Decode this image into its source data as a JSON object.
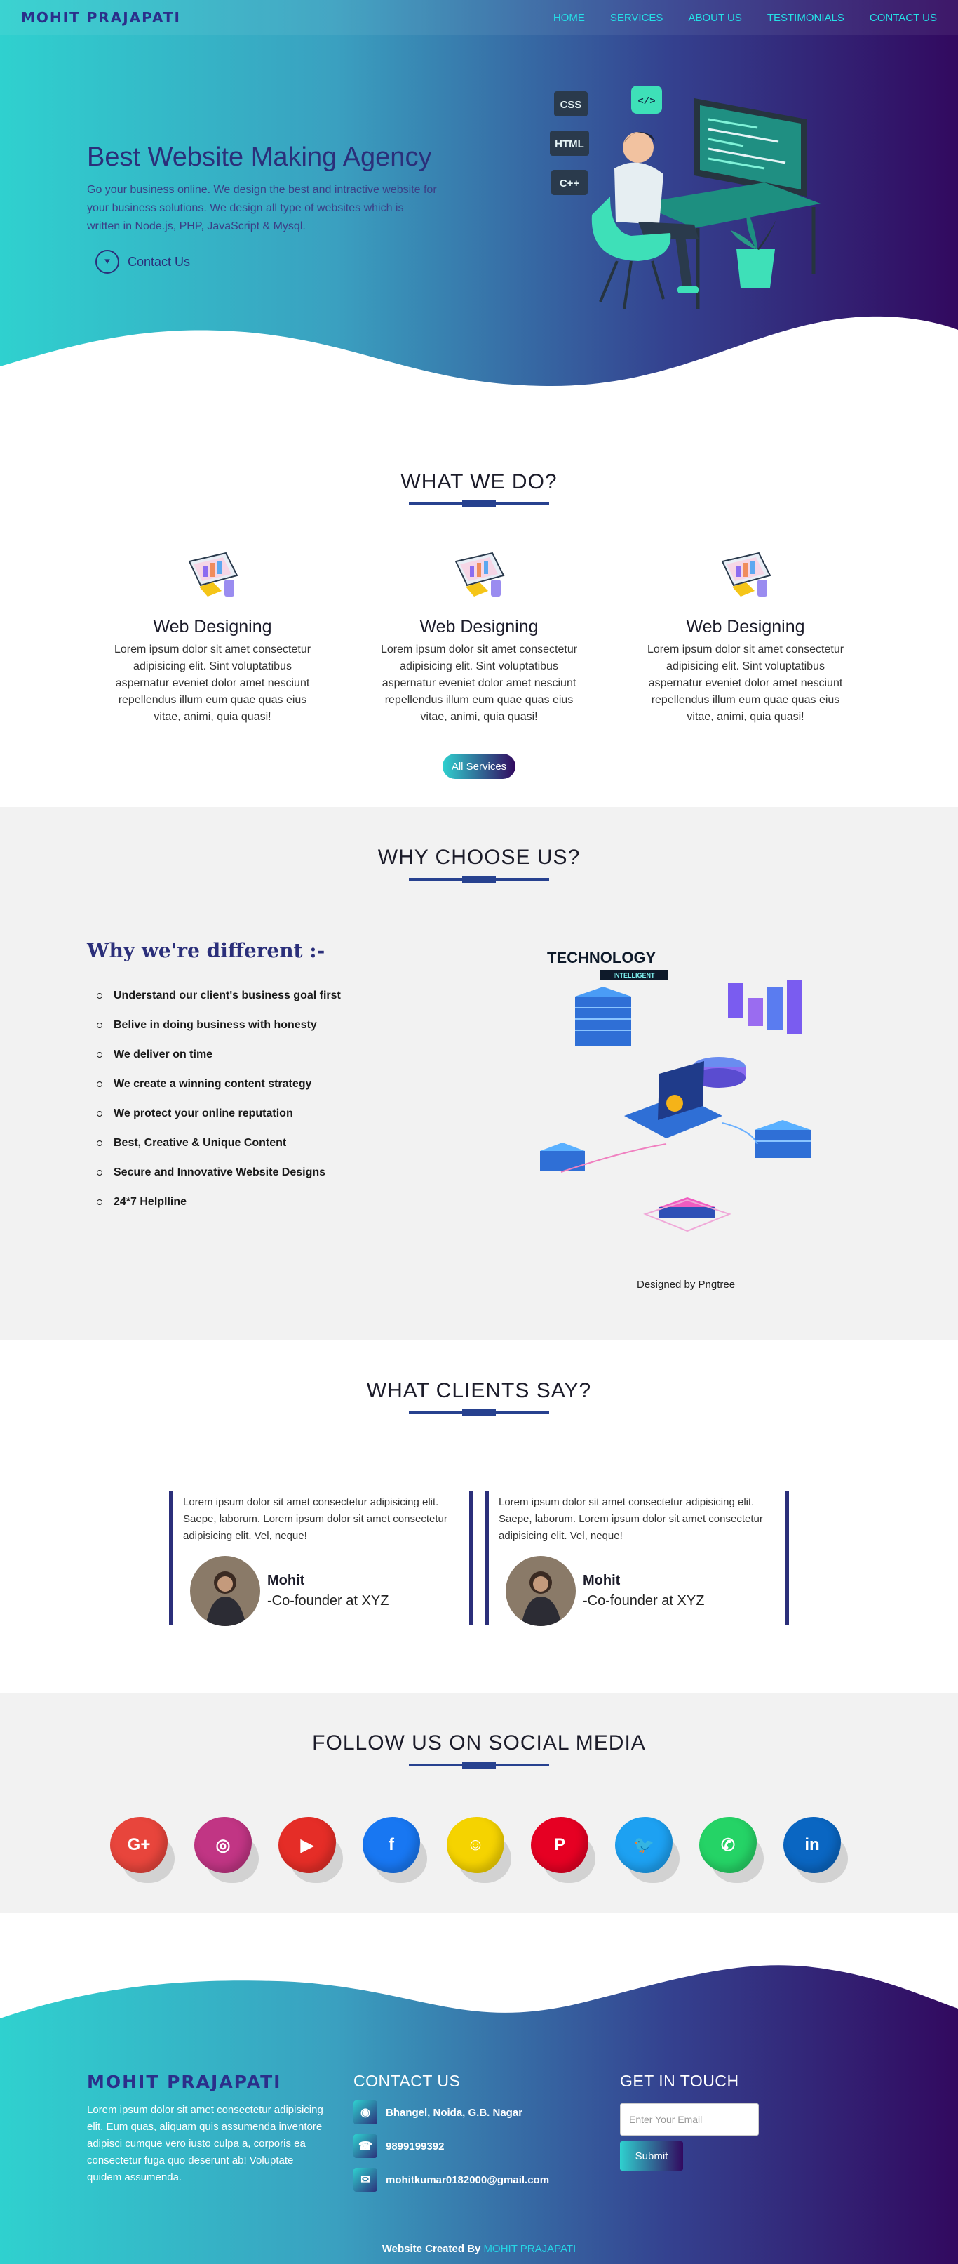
{
  "nav": {
    "logo": "MOHIT PRAJAPATI",
    "items": [
      "HOME",
      "SERVICES",
      "ABOUT US",
      "TESTIMONIALS",
      "CONTACT US"
    ]
  },
  "hero": {
    "title": "Best Website Making Agency",
    "subtitle": "Go your business online. We design the best and intractive website for your business solutions. We design all type of websites which is written in Node.js, PHP, JavaScript & Mysql.",
    "cta": "Contact Us",
    "art_labels": [
      "CSS",
      "HTML",
      "C++"
    ]
  },
  "what": {
    "title": "WHAT WE DO?",
    "cards": [
      {
        "title": "Web Designing",
        "text": "Lorem ipsum dolor sit amet consectetur adipisicing elit. Sint voluptatibus aspernatur eveniet dolor amet nesciunt repellendus illum eum quae quas eius vitae, animi, quia quasi!"
      },
      {
        "title": "Web Designing",
        "text": "Lorem ipsum dolor sit amet consectetur adipisicing elit. Sint voluptatibus aspernatur eveniet dolor amet nesciunt repellendus illum eum quae quas eius vitae, animi, quia quasi!"
      },
      {
        "title": "Web Designing",
        "text": "Lorem ipsum dolor sit amet consectetur adipisicing elit. Sint voluptatibus aspernatur eveniet dolor amet nesciunt repellendus illum eum quae quas eius vitae, animi, quia quasi!"
      }
    ],
    "button": "All Services"
  },
  "why": {
    "title": "WHY CHOOSE US?",
    "subtitle": "Why we're different :-",
    "items": [
      "Understand our client's business goal first",
      "Belive in doing business with honesty",
      "We deliver on time",
      "We create a winning content strategy",
      "We protect your online reputation",
      "Best, Creative & Unique Content",
      "Secure and Innovative Website Designs",
      "24*7 Helplline"
    ],
    "art_text": [
      "TECHNOLOGY",
      "INTELLIGENT"
    ],
    "credit": "Designed by Pngtree"
  },
  "clients": {
    "title": "WHAT CLIENTS SAY?",
    "testimonials": [
      {
        "text": "Lorem ipsum dolor sit amet consectetur adipisicing elit. Saepe, laborum. Lorem ipsum dolor sit amet consectetur adipisicing elit. Vel, neque!",
        "name": "Mohit",
        "role": "-Co-founder at XYZ"
      },
      {
        "text": "Lorem ipsum dolor sit amet consectetur adipisicing elit. Saepe, laborum. Lorem ipsum dolor sit amet consectetur adipisicing elit. Vel, neque!",
        "name": "Mohit",
        "role": "-Co-founder at XYZ"
      }
    ]
  },
  "social": {
    "title": "FOLLOW US ON SOCIAL MEDIA",
    "icons": [
      {
        "name": "google-plus",
        "glyph": "G+",
        "color": "#e8453c"
      },
      {
        "name": "instagram",
        "glyph": "◎",
        "color": "#c13584"
      },
      {
        "name": "youtube",
        "glyph": "▶",
        "color": "#e52d27"
      },
      {
        "name": "facebook",
        "glyph": "f",
        "color": "#1877f2"
      },
      {
        "name": "snapchat",
        "glyph": "☺",
        "color": "#f5d300"
      },
      {
        "name": "pinterest",
        "glyph": "P",
        "color": "#e60023"
      },
      {
        "name": "twitter",
        "glyph": "🐦",
        "color": "#1da1f2"
      },
      {
        "name": "whatsapp",
        "glyph": "✆",
        "color": "#25d366"
      },
      {
        "name": "linkedin",
        "glyph": "in",
        "color": "#0a66c2"
      }
    ]
  },
  "footer": {
    "logo": "MOHIT PRAJAPATI",
    "about": "Lorem ipsum dolor sit amet consectetur adipisicing elit. Eum quas, aliquam quis assumenda inventore adipisci cumque vero iusto culpa a, corporis ea consectetur fuga quo deserunt ab! Voluptate quidem assumenda.",
    "contact_title": "CONTACT US",
    "address": "Bhangel, Noida, G.B. Nagar",
    "phone": "9899199392",
    "email": "mohitkumar0182000@gmail.com",
    "touch_title": "GET IN TOUCH",
    "email_placeholder": "Enter Your Email",
    "submit": "Submit",
    "credit_prefix": "Website Created By",
    "credit_name": "MOHIT PRAJAPATI"
  },
  "colors": {
    "gradient_start": "#2fd1cf",
    "gradient_end": "#32095f",
    "heading_blue": "#2b2f7a",
    "nav_link": "#25e0e6",
    "section_gray": "#f2f2f2"
  }
}
